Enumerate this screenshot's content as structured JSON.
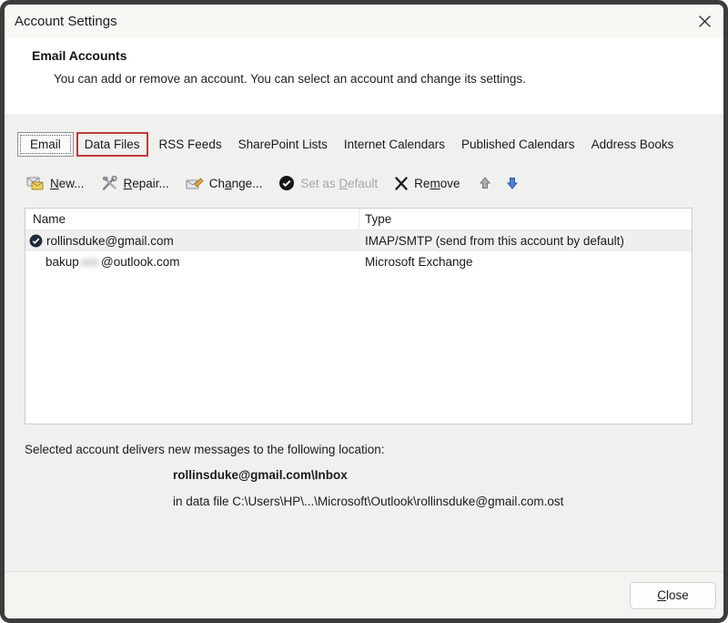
{
  "window": {
    "title": "Account Settings"
  },
  "header": {
    "title": "Email Accounts",
    "description": "You can add or remove an account. You can select an account and change its settings."
  },
  "tabs": [
    {
      "label": "Email",
      "active": true
    },
    {
      "label": "Data Files",
      "annotated": true,
      "annotation_color": "#bf3a3a"
    },
    {
      "label": "RSS Feeds"
    },
    {
      "label": "SharePoint Lists"
    },
    {
      "label": "Internet Calendars"
    },
    {
      "label": "Published Calendars"
    },
    {
      "label": "Address Books"
    }
  ],
  "toolbar": {
    "items": [
      {
        "name": "new",
        "pre": "",
        "key": "N",
        "post": "ew...",
        "enabled": true
      },
      {
        "name": "repair",
        "pre": "",
        "key": "R",
        "post": "epair...",
        "enabled": true
      },
      {
        "name": "change",
        "pre": "Ch",
        "key": "a",
        "post": "nge...",
        "enabled": true
      },
      {
        "name": "set_default",
        "pre": "Set as ",
        "key": "D",
        "post": "efault",
        "enabled": false
      },
      {
        "name": "remove",
        "pre": "Re",
        "key": "m",
        "post": "ove",
        "enabled": true
      }
    ],
    "move_up_enabled": false,
    "move_down_enabled": true
  },
  "table": {
    "columns": [
      "Name",
      "Type"
    ],
    "rows": [
      {
        "name": "rollinsduke@gmail.com",
        "type": "IMAP/SMTP (send from this account by default)",
        "is_default": true,
        "selected": true
      },
      {
        "name_prefix": "bakup",
        "name_redacted": "xxx",
        "name_suffix": "@outlook.com",
        "type": "Microsoft Exchange",
        "is_default": false,
        "selected": false
      }
    ]
  },
  "details": {
    "intro": "Selected account delivers new messages to the following location:",
    "location": "rollinsduke@gmail.com\\Inbox",
    "data_file": "in data file C:\\Users\\HP\\...\\Microsoft\\Outlook\\rollinsduke@gmail.com.ost"
  },
  "footer": {
    "close": {
      "pre": "",
      "key": "C",
      "post": "lose"
    }
  },
  "colors": {
    "annotation_red": "#bf3a3a",
    "arrow_blue": "#4a80dd",
    "arrow_gray_disabled": "#adadad",
    "disabled_text": "#a7a7a7",
    "selected_row_bg": "#efefed"
  }
}
